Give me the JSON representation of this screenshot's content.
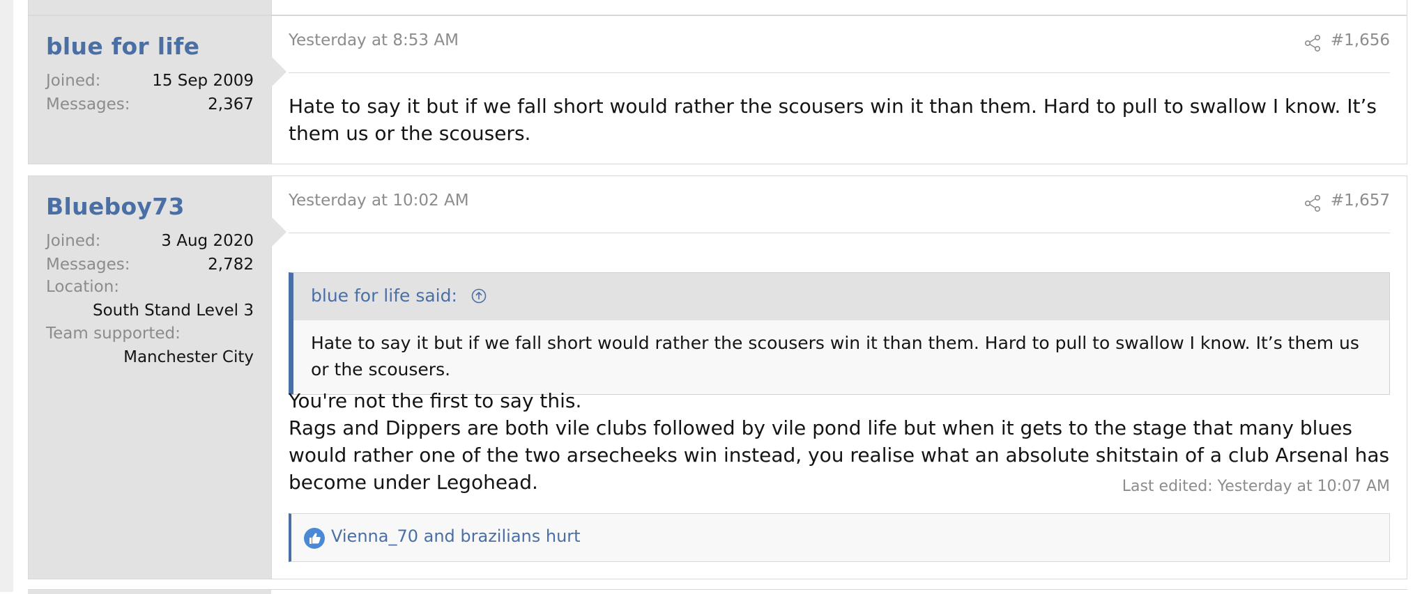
{
  "posts": [
    {
      "username": "blue for life",
      "joined_label": "Joined:",
      "joined": "15 Sep 2009",
      "messages_label": "Messages:",
      "messages": "2,367",
      "date": "Yesterday at 8:53 AM",
      "post_number": "#1,656",
      "body": "Hate to say it but if we fall short would rather the scousers win it than them. Hard to pull to swallow I know. It’s them us or the scousers."
    },
    {
      "username": "Blueboy73",
      "joined_label": "Joined:",
      "joined": "3 Aug 2020",
      "messages_label": "Messages:",
      "messages": "2,782",
      "location_label": "Location:",
      "location": "South Stand Level 3",
      "team_label": "Team supported:",
      "team": "Manchester City",
      "date": "Yesterday at 10:02 AM",
      "post_number": "#1,657",
      "quote_author": "blue for life said:",
      "quote_text": "Hate to say it but if we fall short would rather the scousers win it than them. Hard to pull to swallow I know. It’s them us or the scousers.",
      "body_line1": "You're not the first to say this.",
      "body_line2": "Rags and Dippers are both vile clubs followed by vile pond life but when it gets to the stage that many blues would rather one of the two arsecheeks win instead, you realise what an absolute shitstain of a club Arsenal has become under Legohead.",
      "last_edited": "Last edited: Yesterday at 10:07 AM",
      "reactions": "Vienna_70 and brazilians hurt"
    }
  ],
  "colors": {
    "accent": "#4a6fa5",
    "user_panel": "#e2e2e2",
    "muted_text": "#8c8c8c",
    "border": "#d8d8d8"
  },
  "icons": {
    "share": "share-icon",
    "quote_jump": "arrow-up-circle-icon",
    "like": "thumbs-up-icon"
  }
}
